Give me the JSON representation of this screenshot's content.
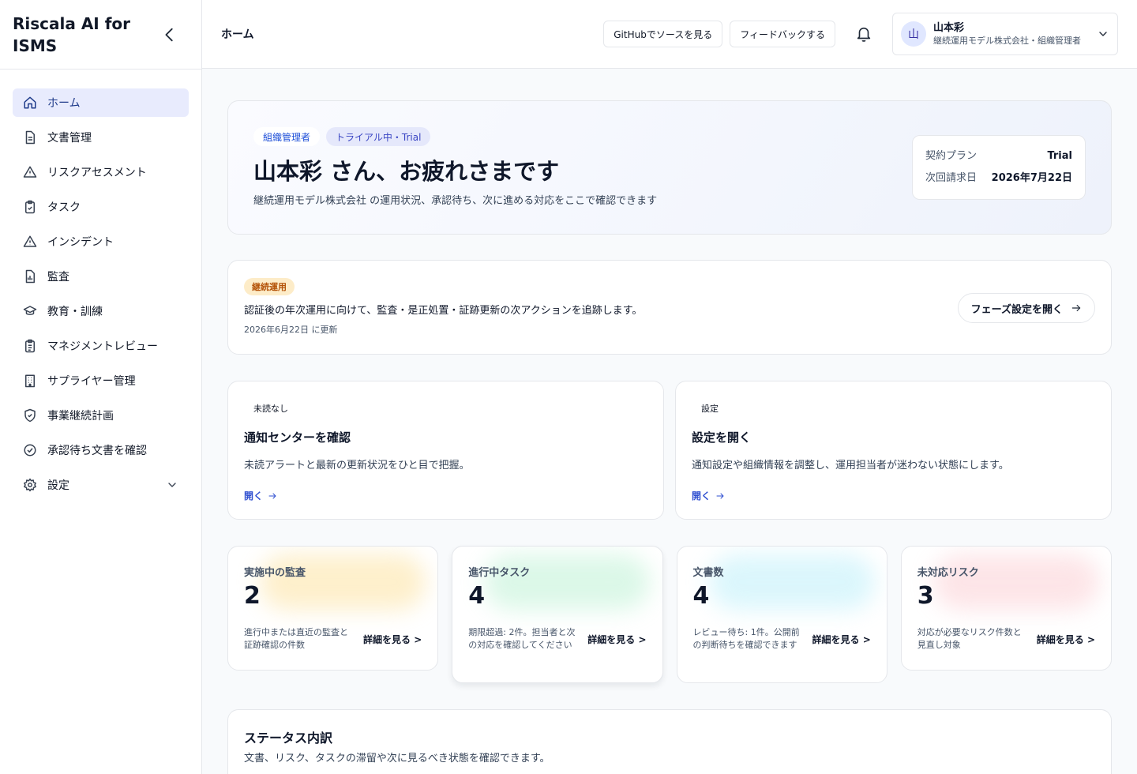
{
  "sidebar": {
    "brand": "Riscala AI for ISMS",
    "items": [
      {
        "label": "ホーム",
        "icon": "home-icon"
      },
      {
        "label": "文書管理",
        "icon": "document-icon"
      },
      {
        "label": "リスクアセスメント",
        "icon": "warning-icon"
      },
      {
        "label": "タスク",
        "icon": "clipboard-check-icon"
      },
      {
        "label": "インシデント",
        "icon": "warning-icon"
      },
      {
        "label": "監査",
        "icon": "report-icon"
      },
      {
        "label": "教育・訓練",
        "icon": "graduation-cap-icon"
      },
      {
        "label": "マネジメントレビュー",
        "icon": "clipboard-list-icon"
      },
      {
        "label": "サプライヤー管理",
        "icon": "building-icon"
      },
      {
        "label": "事業継続計画",
        "icon": "shield-check-icon"
      },
      {
        "label": "承認待ち文書を確認",
        "icon": "check-circle-icon"
      },
      {
        "label": "設定",
        "icon": "gear-icon"
      }
    ]
  },
  "header": {
    "title": "ホーム",
    "github_button": "GitHubでソースを見る",
    "feedback_button": "フィードバックする",
    "user": {
      "initial": "山",
      "name": "山本彩",
      "org": "継続運用モデル株式会社・組織管理者"
    }
  },
  "hero": {
    "role_badge": "組織管理者",
    "trial_badge": "トライアル中・Trial",
    "greeting": "山本彩 さん、お疲れさまです",
    "description": "継続運用モデル株式会社 の運用状況、承認待ち、次に進める対応をここで確認できます",
    "plan_label": "契約プラン",
    "plan_value": "Trial",
    "billing_label": "次回請求日",
    "billing_value": "2026年7月22日"
  },
  "phase": {
    "badge": "継続運用",
    "description": "認証後の年次運用に向けて、監査・是正処置・証跡更新の次アクションを追跡します。",
    "updated": "2026年6月22日 に更新",
    "button": "フェーズ設定を開く"
  },
  "cards": [
    {
      "tag": "未読なし",
      "title": "通知センターを確認",
      "description": "未読アラートと最新の更新状況をひと目で把握。",
      "link": "開く"
    },
    {
      "tag": "設定",
      "title": "設定を開く",
      "description": "通知設定や組織情報を調整し、運用担当者が迷わない状態にします。",
      "link": "開く"
    }
  ],
  "stats": [
    {
      "label": "実施中の監査",
      "value": "2",
      "note": "進行中または直近の監査と証跡確認の件数",
      "link": "詳細を見る >",
      "color": "#fde7b0"
    },
    {
      "label": "進行中タスク",
      "value": "4",
      "note": "期限超過: 2件。担当者と次の対応を確認してください",
      "link": "詳細を見る >",
      "color": "#c9f4dc"
    },
    {
      "label": "文書数",
      "value": "4",
      "note": "レビュー待ち: 1件。公開前の判断待ちを確認できます",
      "link": "詳細を見る >",
      "color": "#c8f2fb"
    },
    {
      "label": "未対応リスク",
      "value": "3",
      "note": "対応が必要なリスク件数と見直し対象",
      "link": "詳細を見る >",
      "color": "#fcd7db"
    }
  ],
  "status": {
    "title": "ステータス内訳",
    "description": "文書、リスク、タスクの滞留や次に見るべき状態を確認できます。"
  }
}
